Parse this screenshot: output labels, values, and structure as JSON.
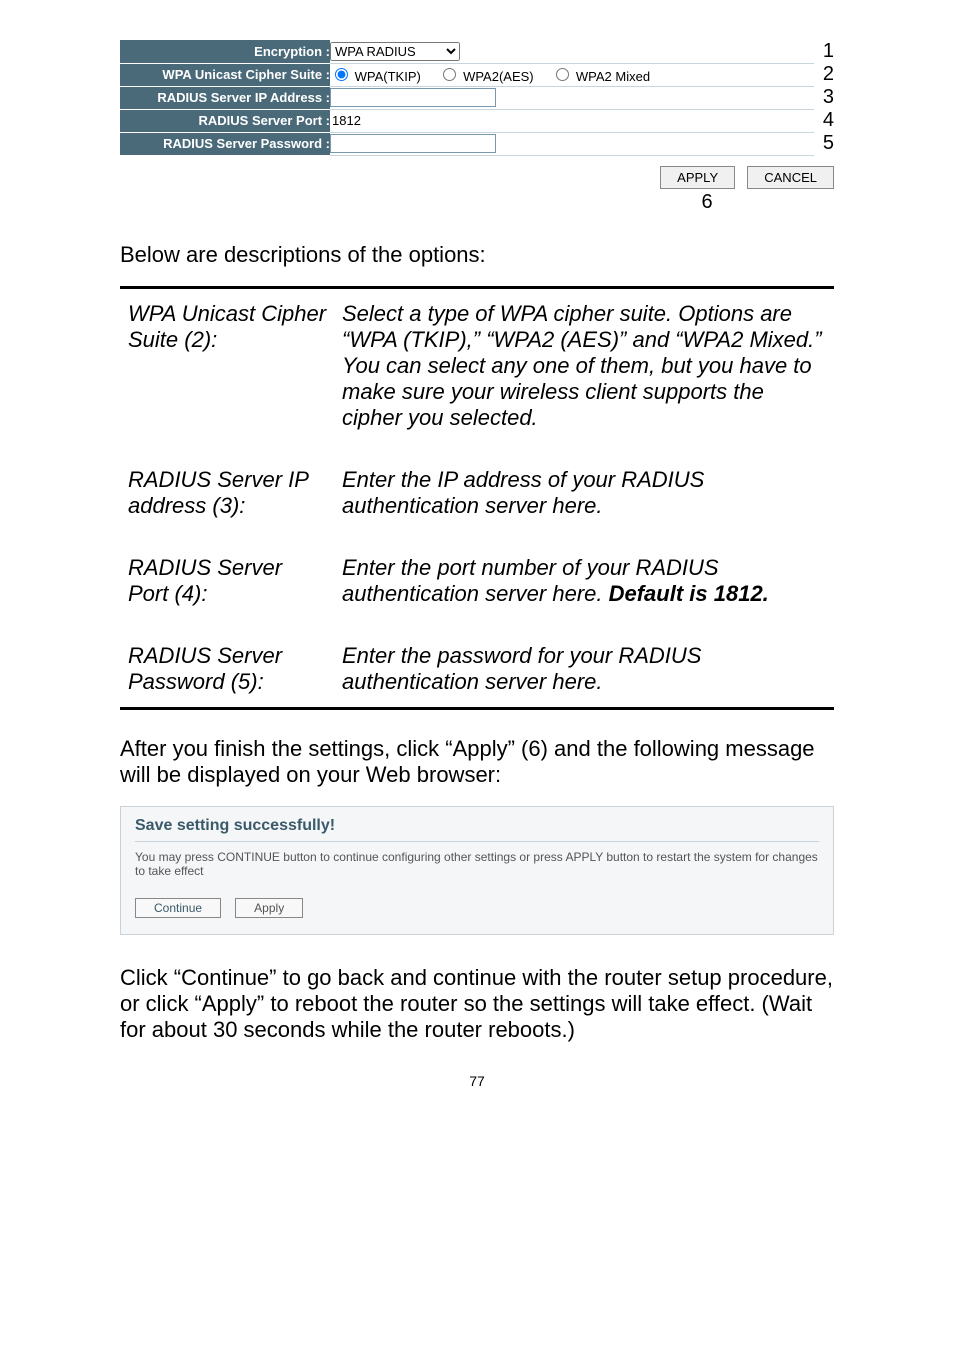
{
  "form": {
    "rows": {
      "encryption_label": "Encryption :",
      "encryption_value": "WPA RADIUS",
      "cipher_label": "WPA Unicast Cipher Suite :",
      "cipher_opts": {
        "tkip": "WPA(TKIP)",
        "aes": "WPA2(AES)",
        "mixed": "WPA2 Mixed"
      },
      "ip_label": "RADIUS Server IP Address :",
      "port_label": "RADIUS Server Port :",
      "port_value": "1812",
      "pwd_label": "RADIUS Server Password :"
    },
    "nums": {
      "r1": "1",
      "r2": "2",
      "r3": "3",
      "r4": "4",
      "r5": "5",
      "r6": "6"
    },
    "buttons": {
      "apply": "APPLY",
      "cancel": "CANCEL"
    }
  },
  "intro": "Below are descriptions of the options:",
  "defs": {
    "t1": "WPA Unicast Cipher Suite (2):",
    "d1": "Select a type of WPA cipher suite. Options are “WPA (TKIP),” “WPA2 (AES)” and “WPA2 Mixed.” You can select any one of them, but you have to make sure your wireless client supports the cipher you selected.",
    "t2": "RADIUS Server IP address (3):",
    "d2": "Enter the IP address of your RADIUS authentication server here.",
    "t3": "RADIUS Server Port (4):",
    "d3a": "Enter the port number of your RADIUS authentication server here. ",
    "d3b": "Default is 1812.",
    "t4": "RADIUS Server Password (5):",
    "d4": "Enter the password for your RADIUS authentication server here."
  },
  "after": "After you finish the settings, click “Apply” (6) and the following message will be displayed on your Web browser:",
  "save": {
    "title": "Save setting successfully!",
    "msg": "You may press CONTINUE button to continue configuring other settings or press APPLY button to restart the system for changes to take effect",
    "cont": "Continue",
    "apply": "Apply"
  },
  "closing": "Click “Continue” to go back and continue with the router setup procedure, or click “Apply” to reboot the router so the settings will take effect. (Wait for about 30 seconds while the router reboots.)",
  "pgnum": "77"
}
